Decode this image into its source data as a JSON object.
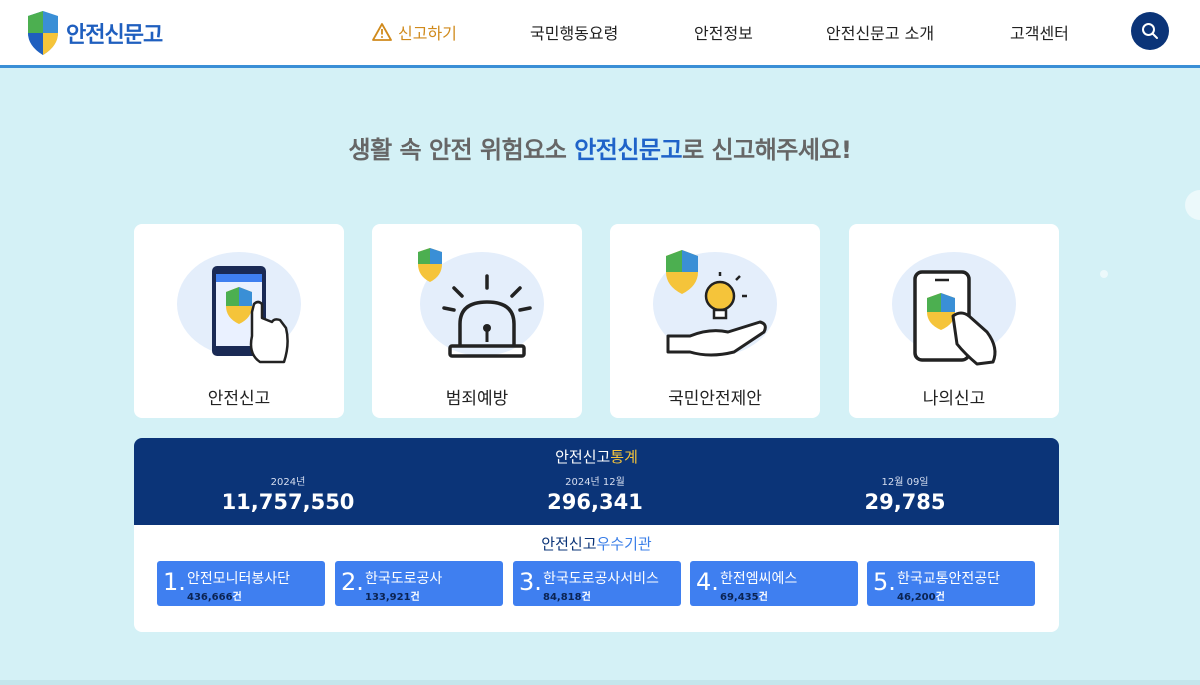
{
  "header": {
    "logo_text": "안전신문고",
    "nav": [
      {
        "label": "신고하기"
      },
      {
        "label": "국민행동요령"
      },
      {
        "label": "안전정보"
      },
      {
        "label": "안전신문고 소개"
      },
      {
        "label": "고객센터"
      }
    ]
  },
  "hero": {
    "title_pre": "생활 속 안전 위험요소 ",
    "title_highlight": "안전신문고",
    "title_post": "로 신고해주세요!"
  },
  "cards": [
    {
      "label": "안전신고",
      "icon": "phone-touch-icon"
    },
    {
      "label": "범죄예방",
      "icon": "siren-icon"
    },
    {
      "label": "국민안전제안",
      "icon": "lightbulb-hand-icon"
    },
    {
      "label": "나의신고",
      "icon": "my-report-phone-icon"
    }
  ],
  "stats": {
    "title_pre": "안전신고",
    "title_highlight": "통계",
    "items": [
      {
        "period": "2024년",
        "value": "11,757,550"
      },
      {
        "period": "2024년 12월",
        "value": "296,341"
      },
      {
        "period": "12월 09일",
        "value": "29,785"
      }
    ]
  },
  "agencies": {
    "title_pre": "안전신고",
    "title_highlight": "우수기관",
    "items": [
      {
        "rank": "1.",
        "name": "안전모니터봉사단",
        "count": "436,666",
        "unit": "건"
      },
      {
        "rank": "2.",
        "name": "한국도로공사",
        "count": "133,921",
        "unit": "건"
      },
      {
        "rank": "3.",
        "name": "한국도로공사서비스",
        "count": "84,818",
        "unit": "건"
      },
      {
        "rank": "4.",
        "name": "한전엠씨에스",
        "count": "69,435",
        "unit": "건"
      },
      {
        "rank": "5.",
        "name": "한국교통안전공단",
        "count": "46,200",
        "unit": "건"
      }
    ]
  },
  "colors": {
    "navy": "#0b3478",
    "accent_blue": "#3f7ff0",
    "background": "#d4f1f6",
    "highlight_yellow": "#f5c43a",
    "report_orange": "#d08a1c"
  }
}
